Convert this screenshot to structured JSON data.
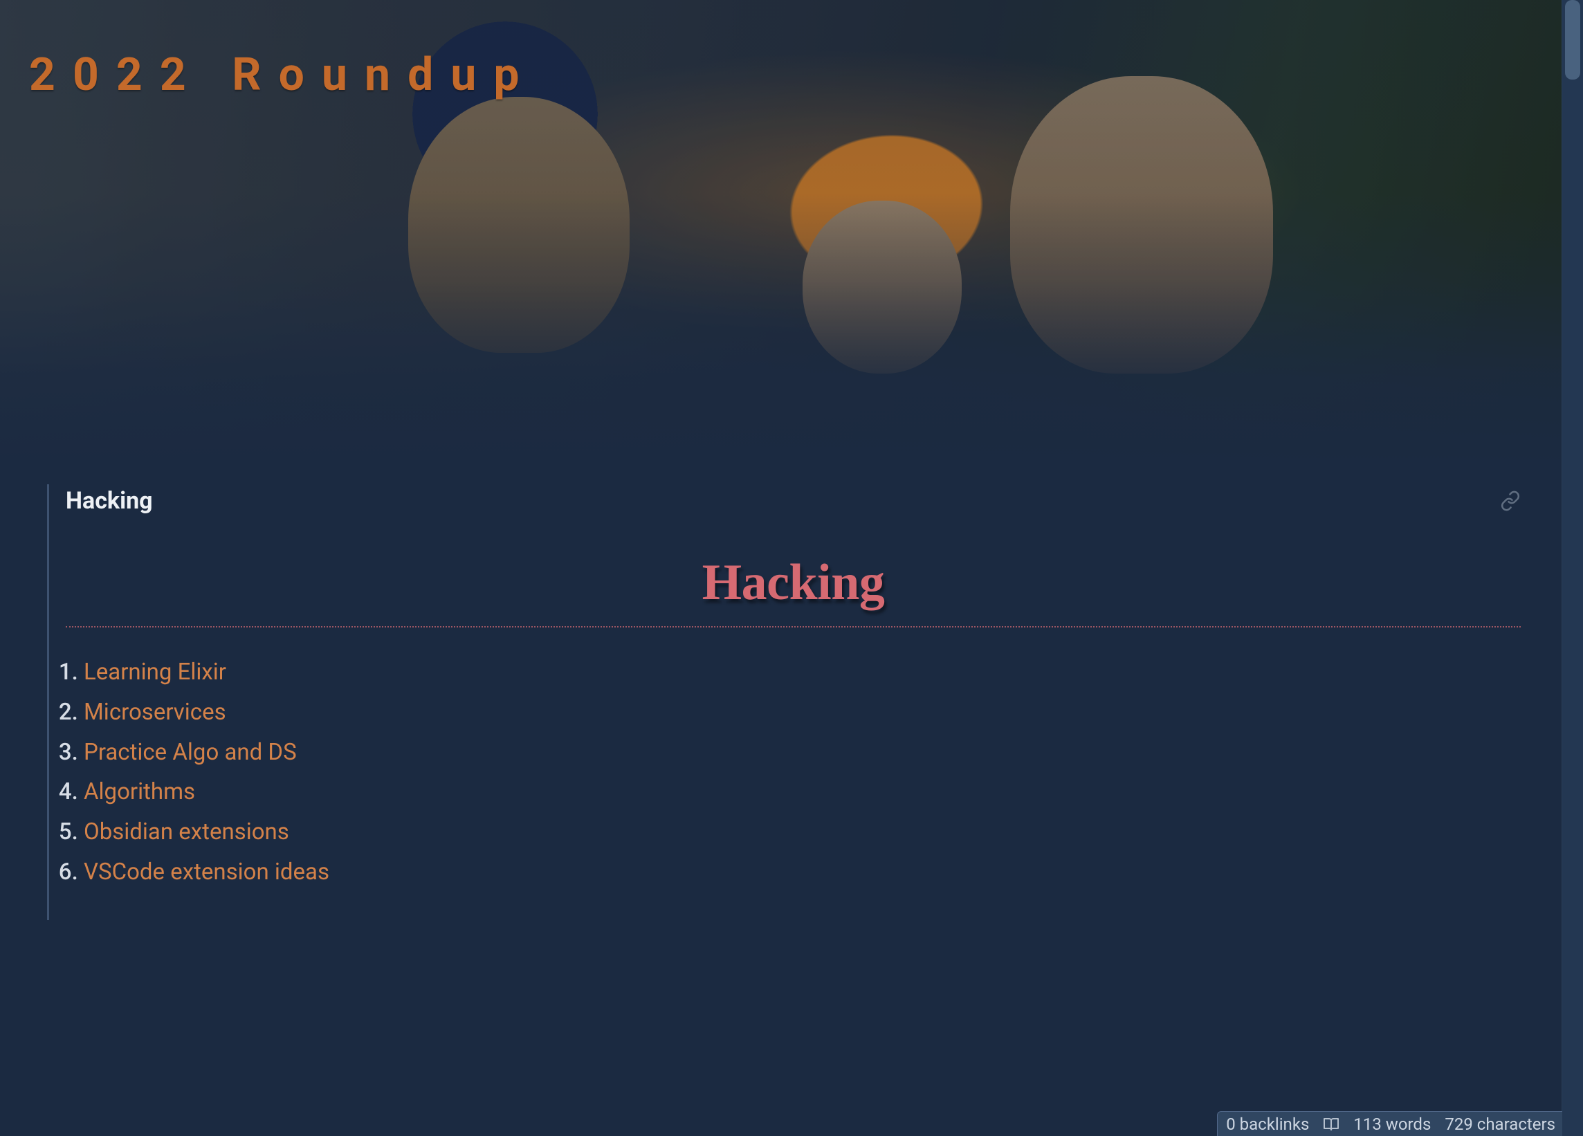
{
  "page": {
    "title": "2022 Roundup"
  },
  "section": {
    "label": "Hacking",
    "heading": "Hacking"
  },
  "items": [
    "Learning Elixir",
    "Microservices",
    "Practice Algo and DS",
    "Algorithms",
    "Obsidian extensions",
    "VSCode extension ideas"
  ],
  "status": {
    "backlinks": "0 backlinks",
    "words": "113 words",
    "characters": "729 characters"
  },
  "icons": {
    "link": "link-icon",
    "book": "book-open-icon"
  }
}
